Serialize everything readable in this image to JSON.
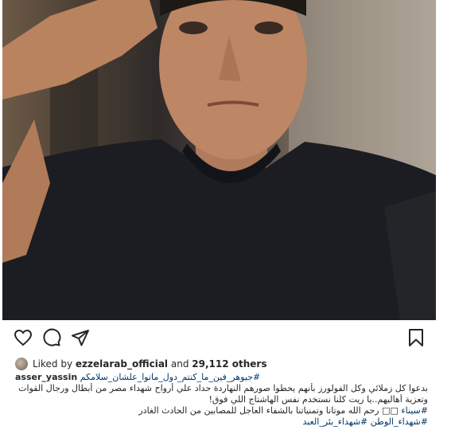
{
  "post": {
    "likes": {
      "prefix": "Liked by",
      "user": "ezzelarab_official",
      "middle": "and",
      "count": "29,112 others"
    },
    "caption": {
      "username": "asser_yassin",
      "hashtags_line1": "#جيوهر_فين_ما_كنتم_دول_ماتوا_علشان_سلامكم",
      "line2": "بدعوا كل زملائي وكل الفولورز بأنهم يحطوا صورهم النهاردة حداد علي أرواح شهداء مصر من أبطال ورجال القوات المسلحة",
      "line3": "!وتعزية أهاليهم..يا ريت كلنا نستخدم نفس الهاشتاج اللي فوق",
      "line4_tag": "#سيناء",
      "line4_text": "رحم الله موتانا وتمنياتنا بالشفاء العاجل للمصابين من الحادث الغادر",
      "line4_marks": "□□",
      "line5": "#شهداء_الوطن #شهداء_بئر_العبد"
    },
    "icons": {
      "like": "heart-icon",
      "comment": "comment-icon",
      "share": "share-icon",
      "save": "bookmark-icon"
    }
  }
}
